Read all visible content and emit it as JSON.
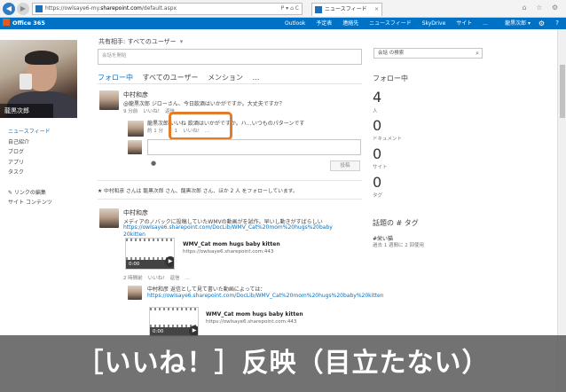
{
  "browser": {
    "url_prefix": "https://owlsaye6-my.",
    "url_host": "sharepoint.com",
    "url_path": "/default.aspx",
    "url_controls": "P ▾ ⌂ C",
    "tabs": [
      {
        "label": "ニュースフィード"
      }
    ],
    "nav_back": "◀",
    "nav_forward": "▶",
    "tab_close": "×",
    "window_icons": "⌂ ☆ ⚙"
  },
  "suite": {
    "logo": "Office 365",
    "links": [
      "Outlook",
      "予定表",
      "連絡先",
      "ニュースフィード",
      "SkyDrive",
      "サイト",
      "..."
    ],
    "user": "龍黒次郎 ▾",
    "gear": "⚙",
    "help": "?"
  },
  "profile": {
    "name": "龍黒次郎"
  },
  "left_nav": {
    "items": [
      "ニュースフィード",
      "自己紹介",
      "ブログ",
      "アプリ",
      "タスク"
    ],
    "links": [
      "✎ リンクの編集",
      "サイト コンテンツ"
    ]
  },
  "share": {
    "label": "共有相手: すべてのユーザー",
    "caret": "▾",
    "placeholder": "会話を開始"
  },
  "feed_tabs": [
    "フォロー中",
    "すべてのユーザー",
    "メンション",
    "..."
  ],
  "post1": {
    "author": "中村和彦",
    "text": "@龍黒次郎 ジローさん、今日飲酒はいかがですか。大丈夫ですか？",
    "meta": [
      "9 分前",
      "いいね!",
      "返信",
      "..."
    ],
    "reply_text": "龍黒次郎 いいね 飲酒はいかがですか。ハ…いつものパターンです",
    "reply_meta": [
      "約 1 分",
      "♡ 1",
      "いいね!",
      "..."
    ],
    "post_button": "投稿"
  },
  "follow_note": "★ 中村和彦 さんは 龍黒次郎 さん、龍黒次郎 さん、ほか 2 人 をフォローしています。",
  "post2": {
    "author": "中村和彦",
    "text": "メディアのノバックに投稿していたWMVの動画がを試作。早いし動きがすばらしい",
    "link1": "https://owlsaye6.sharepoint.com/DocLib/WMV_Cat%20mom%20hugs%20baby",
    "link2": "20kitten",
    "video_title": "WMV_Cat mom hugs baby kitten",
    "video_url": "https://owlsaye6.sharepoint.com:443",
    "video_time": "0:00",
    "meta": [
      "2 時間前",
      "いいね!",
      "返信",
      "..."
    ],
    "reply_author": "中村和彦",
    "reply_text": "返信として見て書いた動画によっては：",
    "reply_link": "https://owlsaye6.sharepoint.com/DocLib/WMV_Cat%20mom%20hugs%20baby%20kitten",
    "reply_video_title": "WMV_Cat mom hugs baby kitten",
    "reply_video_url": "https://owlsaye6.sharepoint.com:443",
    "reply_video_time": "0:00"
  },
  "right": {
    "search_placeholder": "会話 の検索",
    "search_icon": "⌕",
    "heading": "フォロー中",
    "stats": [
      {
        "value": "4",
        "label": "人"
      },
      {
        "value": "0",
        "label": "ドキュメント"
      },
      {
        "value": "0",
        "label": "サイト"
      },
      {
        "value": "0",
        "label": "タグ"
      }
    ],
    "tags_heading": "話題の # タグ",
    "tag": "#栄い猫",
    "tag_meta": "過去 1 週間に 2 回使用"
  },
  "caption": "［いいね！］反映（目立たない）",
  "colors": {
    "suite_blue": "#0072c6",
    "highlight": "#e07c2a",
    "caption_bg": "#5f5f5f"
  }
}
